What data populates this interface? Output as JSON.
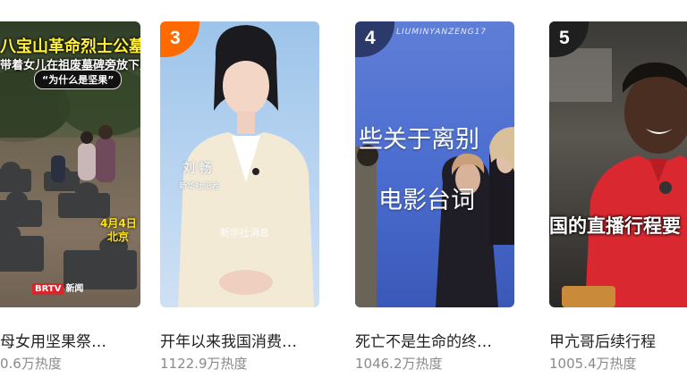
{
  "cards": [
    {
      "title": "母女用坚果祭…",
      "heat": "0.6万热度",
      "overlay_line1": "八宝山革命烈士公墓",
      "overlay_line2": "带着女儿在祖废墓碑旁放下坚果",
      "overlay_tag": "“为什么是坚果”",
      "overlay_date": "4月4日",
      "overlay_place": "北京",
      "brand_a": "BRTV",
      "brand_b": "新闻"
    },
    {
      "rank": "3",
      "title": "开年以来我国消费…",
      "heat": "1122.9万热度",
      "anchor_name": "刘 畅",
      "anchor_role": "新华社记者",
      "watermark": "新华社消息"
    },
    {
      "rank": "4",
      "title": "死亡不是生命的终…",
      "heat": "1046.2万热度",
      "top_text": "LIUMINYANZENG17",
      "overlay_line1": "些关于离别",
      "overlay_line2": "电影台词"
    },
    {
      "rank": "5",
      "title": "甲亢哥后续行程",
      "heat": "1005.4万热度",
      "overlay_line1": "国的直播行程要"
    }
  ],
  "colors": {
    "rank3_badge": "#ff6a00",
    "rank4_badge": "#2b3a6b",
    "rank5_badge": "#1f1f1f",
    "title_text": "#222222",
    "heat_text": "#8a8a8a"
  }
}
